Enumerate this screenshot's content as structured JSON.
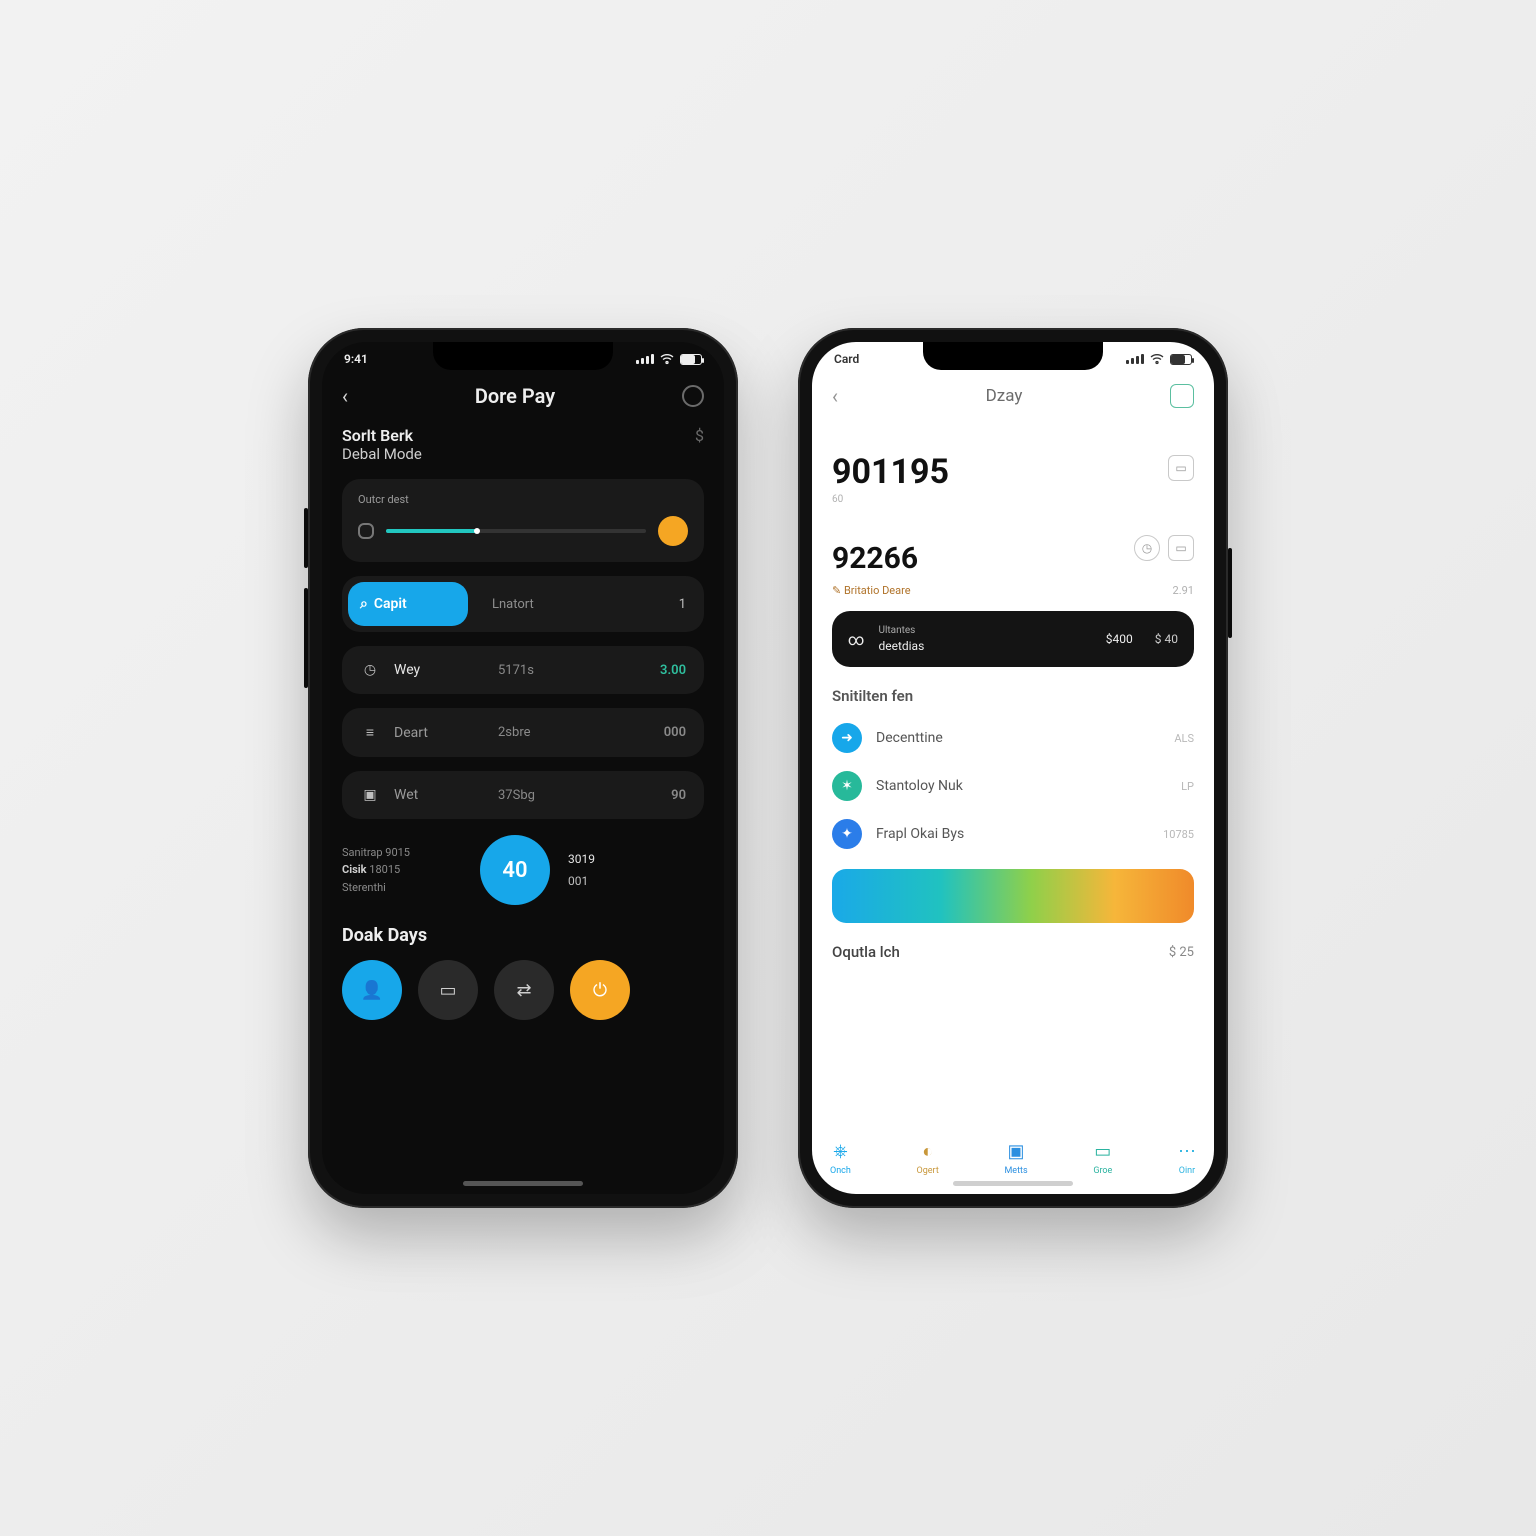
{
  "dark": {
    "status_time": "9:41",
    "header_title": "Dore Pay",
    "sub_title1": "Sorlt Berk",
    "sub_title2": "Debal Mode",
    "slider_label": "Outcr dest",
    "seg_chip": "Capit",
    "seg_mid": "Lnatort",
    "seg_val": "1",
    "row1_label": "Wey",
    "row1_mid": "5171s",
    "row1_val": "3.00",
    "row2_label": "Deart",
    "row2_mid": "2sbre",
    "row2_val": "000",
    "row3_label": "Wet",
    "row3_mid": "37Sbg",
    "row3_val": "90",
    "metrics_line1": "Sanitrap 9015",
    "metrics_line2a": "Cisik",
    "metrics_line2b": "18015",
    "metrics_line3": "Sterenthi",
    "bubble": "40",
    "mval1": "3019",
    "mval2": "001",
    "section_title": "Doak Days"
  },
  "light": {
    "status_time": "Card",
    "header_title": "Dzay",
    "big1": "901195",
    "big1_sub": "60",
    "big2": "92266",
    "sub_left": "Britatio Deare",
    "sub_right": "2.91",
    "card_top": "Ultantes",
    "card_bottom": "deetdias",
    "card_amt1": "$400",
    "card_amt2": "$ 40",
    "section_title": "Snitilten fen",
    "r1_label": "Decenttine",
    "r1_val": "ALS",
    "r2_label": "Stantoloy Nuk",
    "r2_val": "LP",
    "r3_label": "Frapl Okai Bys",
    "r3_val": "10785",
    "orow_label": "Oqutla lch",
    "orow_val": "$ 25",
    "tabs": [
      "Onch",
      "Ogert",
      "Metts",
      "Groe",
      "Oinr"
    ]
  }
}
